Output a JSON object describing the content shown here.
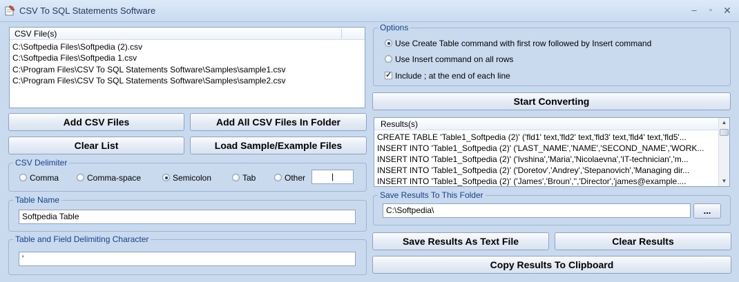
{
  "window": {
    "title": "CSV To SQL Statements Software"
  },
  "csv_files": {
    "header": "CSV File(s)",
    "items": [
      "C:\\Softpedia Files\\Softpedia (2).csv",
      "C:\\Softpedia Files\\Softpedia 1.csv",
      "C:\\Program Files\\CSV To SQL Statements Software\\Samples\\sample1.csv",
      "C:\\Program Files\\CSV To SQL Statements Software\\Samples\\sample2.csv"
    ]
  },
  "buttons": {
    "add_csv": "Add CSV Files",
    "add_folder": "Add All CSV Files In Folder",
    "clear_list": "Clear List",
    "load_sample": "Load Sample/Example Files",
    "start": "Start Converting",
    "browse": "...",
    "save_text": "Save Results As Text File",
    "clear_results": "Clear Results",
    "copy_clipboard": "Copy Results To Clipboard"
  },
  "delimiter": {
    "title": "CSV Delimiter",
    "options": [
      "Comma",
      "Comma-space",
      "Semicolon",
      "Tab",
      "Other"
    ],
    "selected": "Semicolon",
    "other_value": "|"
  },
  "table_name": {
    "title": "Table Name",
    "value": "Softpedia Table"
  },
  "field_char": {
    "title": "Table and Field Delimiting Character",
    "value": "'"
  },
  "options": {
    "title": "Options",
    "create_table": "Use Create Table command with first row followed by Insert command",
    "insert_all": "Use Insert command on all rows",
    "include_semicolon": "Include ; at the end of each line",
    "selected": "create_table",
    "include_checked": true
  },
  "results": {
    "header": "Results(s)",
    "lines": [
      "CREATE TABLE 'Table1_Softpedia (2)' ('fld1' text,'fld2' text,'fld3' text,'fld4' text,'fld5'...",
      "INSERT INTO 'Table1_Softpedia (2)' ('LAST_NAME','NAME','SECOND_NAME','WORK...",
      "INSERT INTO 'Table1_Softpedia (2)' ('Ivshina','Maria','Nicolaevna','IT-technician','m...",
      "INSERT INTO 'Table1_Softpedia (2)' ('Doretov','Andrey','Stepanovich','Managing dir...",
      "INSERT INTO 'Table1_Softpedia (2)' ('James','Broun','','Director','james@example...."
    ]
  },
  "save_folder": {
    "title": "Save Results To This Folder",
    "value": "C:\\Softpedia\\"
  }
}
